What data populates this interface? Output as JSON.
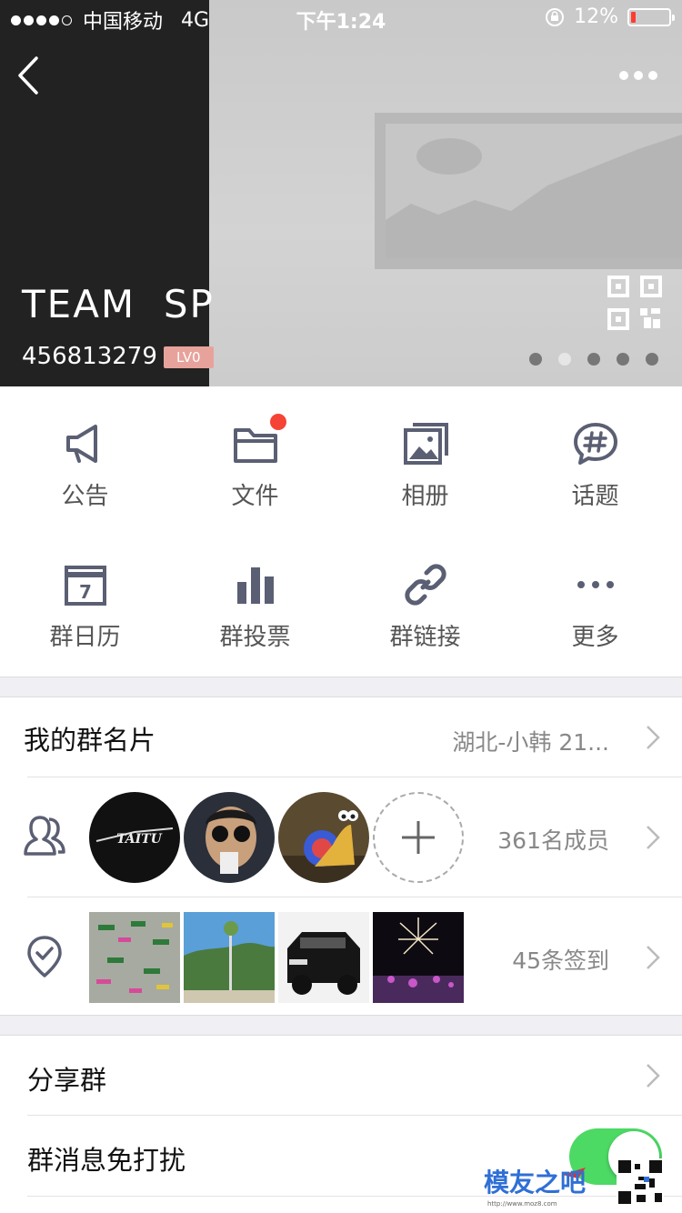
{
  "status_bar": {
    "carrier": "中国移动",
    "network": "4G",
    "time": "下午1:24",
    "battery": "12%",
    "battery_level": 0.12,
    "signal_bars": 4
  },
  "header": {
    "group_name": "TEAM  SP",
    "group_number": "456813279",
    "level": "LV0",
    "carousel_pages": 5,
    "active_page": 1
  },
  "functions": [
    {
      "label": "公告",
      "icon": "megaphone-icon"
    },
    {
      "label": "文件",
      "icon": "folder-icon",
      "badge": true
    },
    {
      "label": "相册",
      "icon": "photos-icon"
    },
    {
      "label": "话题",
      "icon": "topic-hashtag-icon"
    },
    {
      "label": "群日历",
      "icon": "calendar-icon",
      "calendar_day": "7"
    },
    {
      "label": "群投票",
      "icon": "bar-chart-icon"
    },
    {
      "label": "群链接",
      "icon": "link-icon"
    },
    {
      "label": "更多",
      "icon": "more-icon"
    }
  ],
  "card": {
    "title": "我的群名片",
    "value": "湖北-小韩 21..."
  },
  "members": {
    "count_text": "361名成员",
    "avatar_text": "TAITU"
  },
  "checkins": {
    "count_text": "45条签到"
  },
  "settings": {
    "share_label": "分享群",
    "mute_label": "群消息免打扰",
    "mute_enabled": true
  },
  "watermark": {
    "text": "模友之吧",
    "url": "http://www.moz8.com"
  },
  "colors": {
    "accent": "#4cd964",
    "badge_red": "#f54336",
    "icon_gray": "#5b5f73",
    "level_badge": "#e8a29c"
  }
}
